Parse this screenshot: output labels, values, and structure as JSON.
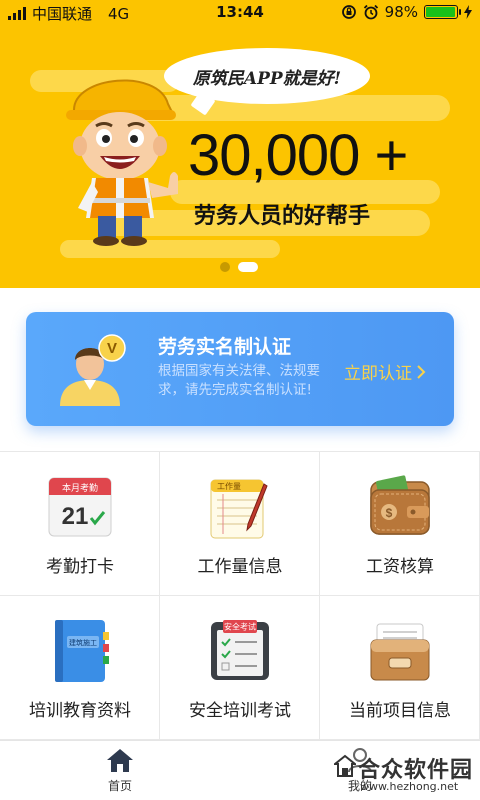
{
  "status_bar": {
    "carrier": "中国联通",
    "network": "4G",
    "time": "13:44",
    "battery_percent": "98%",
    "battery_level": 0.98
  },
  "banner": {
    "speech": "原筑民APP就是好!",
    "big_number": "30,000 +",
    "tagline": "劳务人员的好帮手",
    "slide_count": 2,
    "active_slide": 2
  },
  "verify_card": {
    "title": "劳务实名制认证",
    "description": "根据国家有关法律、法规要求，请先完成实名制认证!",
    "action": "立即认证",
    "badge": "V"
  },
  "grid": {
    "items": [
      {
        "label": "考勤打卡",
        "icon": "calendar-checkin-icon",
        "icon_text_top": "本月考勤",
        "icon_text_date": "21"
      },
      {
        "label": "工作量信息",
        "icon": "notepad-pen-icon",
        "icon_text_top": "工作量"
      },
      {
        "label": "工资核算",
        "icon": "wallet-icon"
      },
      {
        "label": "培训教育资料",
        "icon": "book-icon",
        "icon_text_top": "建筑施工"
      },
      {
        "label": "安全培训考试",
        "icon": "exam-clipboard-icon",
        "icon_text_top": "安全考试"
      },
      {
        "label": "当前项目信息",
        "icon": "folder-drawer-icon"
      }
    ]
  },
  "tabbar": {
    "home_label": "首页",
    "mine_label": "我的"
  },
  "watermark": {
    "title": "合众软件园",
    "url": "www.hezhong.net"
  },
  "colors": {
    "banner_yellow": "#fcc400",
    "card_blue": "#5aa8fb",
    "action_yellow": "#f8d24b"
  }
}
